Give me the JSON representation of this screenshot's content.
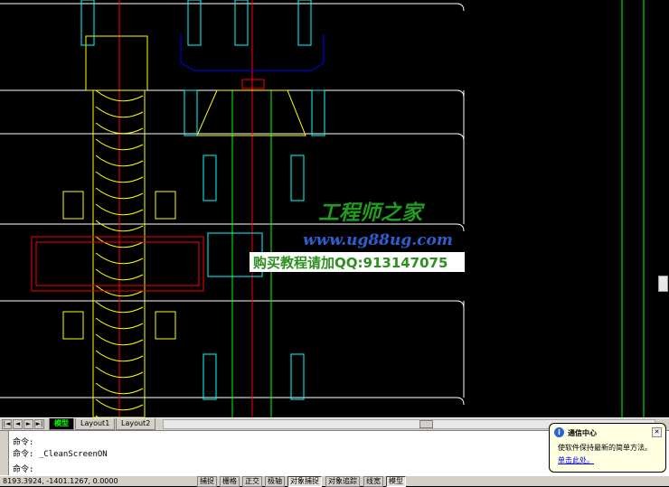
{
  "layout_tabs": [
    {
      "label": "模型",
      "active": true
    },
    {
      "label": "Layout1",
      "active": false
    },
    {
      "label": "Layout2",
      "active": false
    }
  ],
  "command_window": {
    "lines": [
      "命令:",
      "命令: _CleanScreenON",
      "命令:"
    ]
  },
  "status_bar": {
    "coordinates": "8193.3924, -1401.1267, 0.0000",
    "toggles": [
      {
        "label": "捕捉",
        "on": false
      },
      {
        "label": "栅格",
        "on": false
      },
      {
        "label": "正交",
        "on": false
      },
      {
        "label": "极轴",
        "on": false
      },
      {
        "label": "对象捕捉",
        "on": true
      },
      {
        "label": "对象追踪",
        "on": false
      },
      {
        "label": "线宽",
        "on": false
      },
      {
        "label": "模型",
        "on": true
      }
    ]
  },
  "balloon": {
    "title": "通信中心",
    "message": "使软件保持最新的简单方法。",
    "link": "单击此处。"
  },
  "watermark": {
    "name": "工程师之家",
    "url": "www.ug88ug.com",
    "contact": "购买教程请加QQ:913147075"
  },
  "colors": {
    "canvas": "#000000",
    "line_white": "#ffffff",
    "line_yellow": "#ffff00",
    "line_green": "#00ff00",
    "line_red": "#ff0000",
    "line_blue": "#0000ff",
    "line_cyan": "#00ffff"
  }
}
